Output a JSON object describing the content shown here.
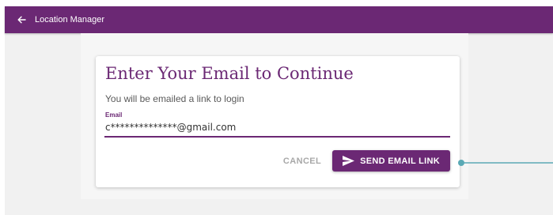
{
  "appbar": {
    "back_icon": "arrow-left-icon",
    "title": "Location Manager"
  },
  "card": {
    "title": "Enter Your Email to Continue",
    "subtitle": "You will be emailed a link to login",
    "email_label": "Email",
    "email_value": "c**************@gmail.com",
    "cancel_label": "CANCEL",
    "send_label": "SEND EMAIL LINK",
    "send_icon": "send-icon"
  },
  "colors": {
    "brand": "#6b2874",
    "background": "#f1f1f1",
    "annotation": "#5aa9b5"
  }
}
